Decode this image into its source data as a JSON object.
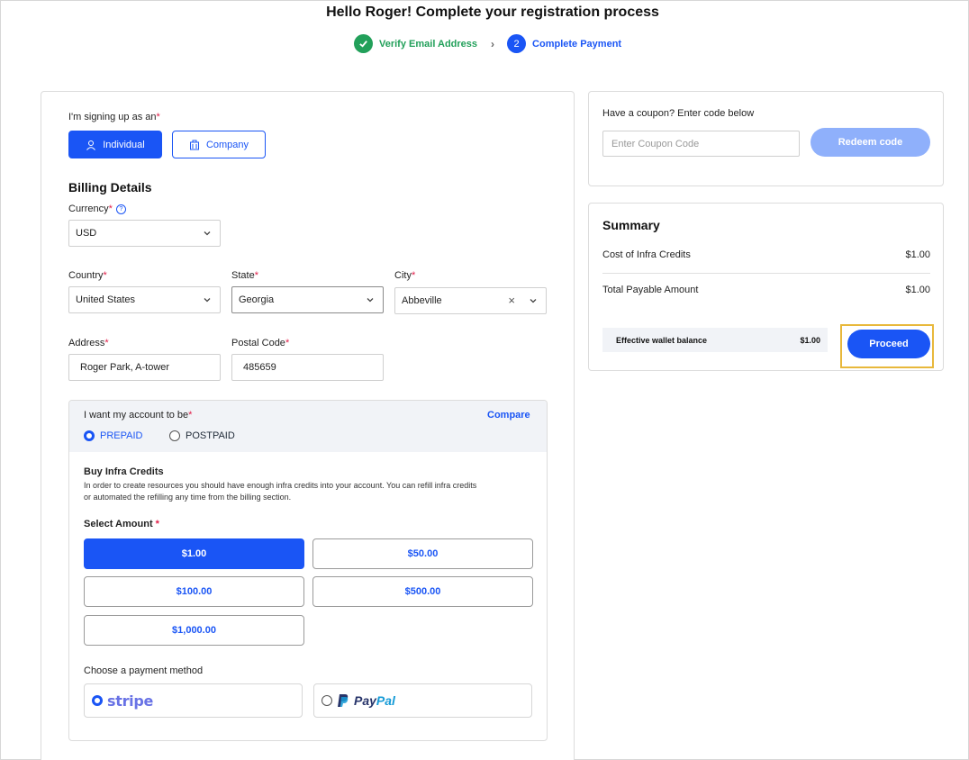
{
  "header": {
    "title": "Hello Roger! Complete your registration process",
    "steps": [
      {
        "number": "1",
        "label": "Verify Email Address",
        "status": "done"
      },
      {
        "number": "2",
        "label": "Complete Payment",
        "status": "active"
      }
    ]
  },
  "signup": {
    "label": "I'm signing up as an",
    "options": [
      "Individual",
      "Company"
    ],
    "selected": "Individual"
  },
  "billing": {
    "title": "Billing Details",
    "currency_label": "Currency",
    "currency_value": "USD",
    "country_label": "Country",
    "country_value": "United States",
    "state_label": "State",
    "state_value": "Georgia",
    "city_label": "City",
    "city_value": "Abbeville",
    "address_label": "Address",
    "address_value": "Roger Park, A-tower",
    "postal_label": "Postal Code",
    "postal_value": "485659"
  },
  "account": {
    "label": "I want my account to be",
    "compare_link": "Compare",
    "options": [
      "PREPAID",
      "POSTPAID"
    ],
    "selected": "PREPAID",
    "infra_title": "Buy Infra Credits",
    "infra_desc_line1": "In order to create resources you should have enough infra credits into your account. You can refill infra credits",
    "infra_desc_line2": "or automated the refilling any time from the billing section.",
    "amount_label": "Select Amount",
    "amounts": [
      "$1.00",
      "$50.00",
      "$100.00",
      "$500.00",
      "$1,000.00"
    ],
    "selected_amount": "$1.00",
    "payment_label": "Choose a payment method",
    "payment_methods": [
      "stripe",
      "PayPal"
    ],
    "selected_payment": "stripe"
  },
  "coupon": {
    "label": "Have a coupon? Enter code below",
    "placeholder": "Enter Coupon Code",
    "redeem_label": "Redeem code"
  },
  "summary": {
    "title": "Summary",
    "rows": [
      {
        "label": "Cost of Infra Credits",
        "value": "$1.00"
      },
      {
        "label": "Total Payable Amount",
        "value": "$1.00"
      }
    ],
    "wallet_label": "Effective wallet balance",
    "wallet_value": "$1.00",
    "proceed_label": "Proceed"
  },
  "colors": {
    "primary": "#1a55f5",
    "success": "#22a05a",
    "highlight": "#e8b83b",
    "required": "#e11d48"
  }
}
